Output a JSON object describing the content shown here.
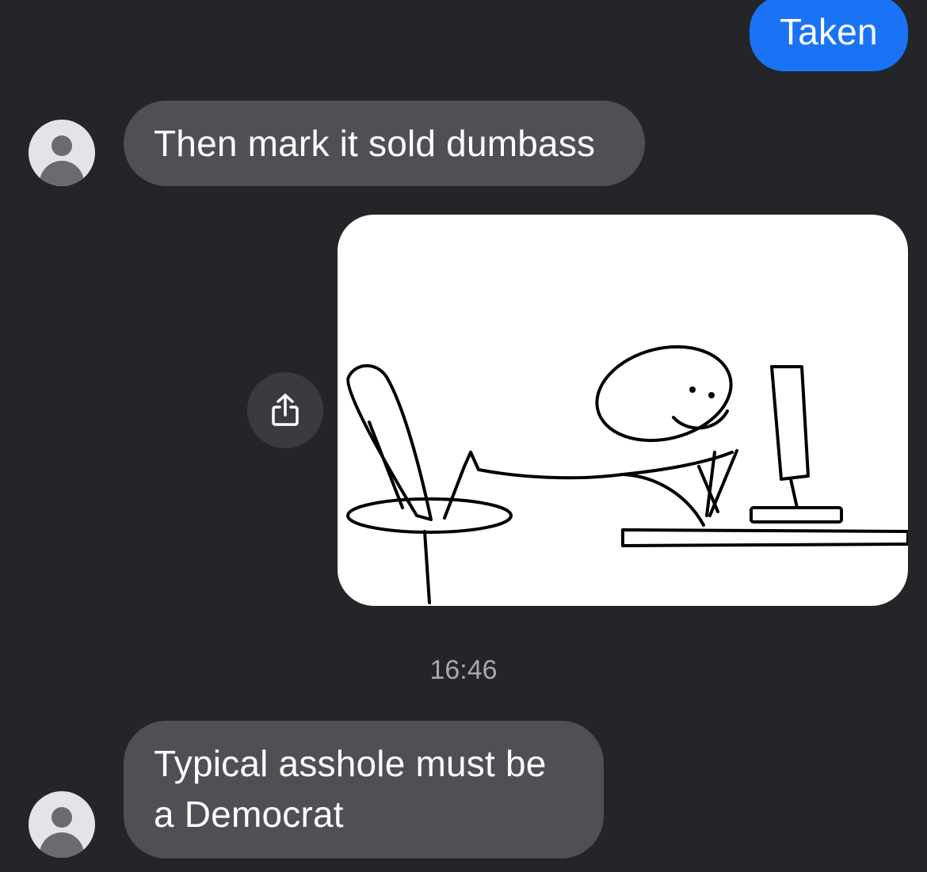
{
  "conversation": {
    "messages": [
      {
        "direction": "outgoing",
        "text": "Taken"
      },
      {
        "direction": "incoming",
        "text": "Then mark it sold dumbass"
      },
      {
        "direction": "outgoing",
        "type": "image",
        "image_description": "stick-figure-at-computer-drawing"
      },
      {
        "direction": "incoming",
        "text_line1": "Typical asshole must be",
        "text_line2": "a Democrat"
      }
    ],
    "timestamp": "16:46"
  },
  "icons": {
    "share": "share-icon",
    "avatar": "person-avatar-icon"
  },
  "colors": {
    "background": "#242528",
    "outgoing_bubble": "#1a73f5",
    "incoming_bubble": "#4f5055",
    "timestamp_text": "#a7a8ad"
  }
}
